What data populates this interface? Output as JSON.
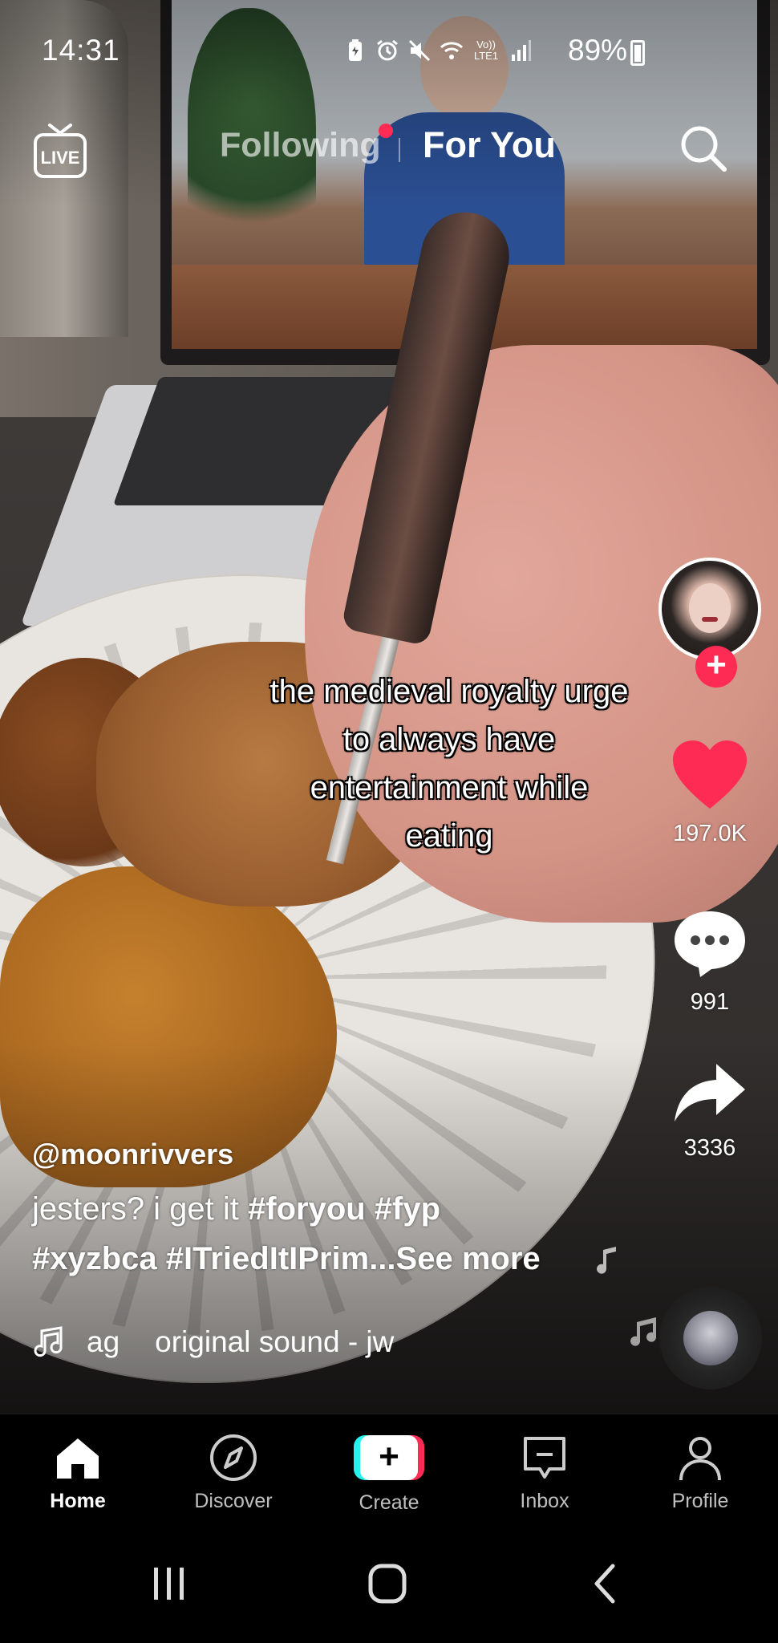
{
  "status_bar": {
    "time": "14:31",
    "battery_percent": "89%",
    "icons": [
      "battery-saver-icon",
      "alarm-icon",
      "mute-icon",
      "wifi-icon",
      "volte-icon",
      "signal-icon",
      "battery-charging-icon"
    ],
    "network_label_top": "Vo))",
    "network_label_bottom": "LTE1"
  },
  "top_nav": {
    "live_label": "LIVE",
    "tab_following": "Following",
    "tab_for_you": "For You",
    "active_tab": "For You",
    "following_has_new": true
  },
  "video": {
    "overlay_caption": "the medieval royalty urge to always have entertainment while eating"
  },
  "actions": {
    "like_count": "197.0K",
    "comment_count": "991",
    "share_count": "3336"
  },
  "info": {
    "username": "@moonrivvers",
    "description_prefix": "jesters? i get it ",
    "hashtags_line": "#foryou #fyp",
    "description_line2": "#xyzbca #ITriedItIPrim...",
    "see_more": "See more",
    "music_artist": "ag",
    "music_title": "original sound - jw"
  },
  "bottom_nav": {
    "items": [
      {
        "label": "Home",
        "icon": "home-icon",
        "active": true
      },
      {
        "label": "Discover",
        "icon": "compass-icon",
        "active": false
      },
      {
        "label": "Create",
        "icon": "create-plus-icon",
        "active": false
      },
      {
        "label": "Inbox",
        "icon": "inbox-icon",
        "active": false
      },
      {
        "label": "Profile",
        "icon": "profile-icon",
        "active": false
      }
    ]
  },
  "colors": {
    "accent_red": "#fe2c55",
    "accent_cyan": "#25f4ee",
    "like_red": "#fe2c55"
  }
}
